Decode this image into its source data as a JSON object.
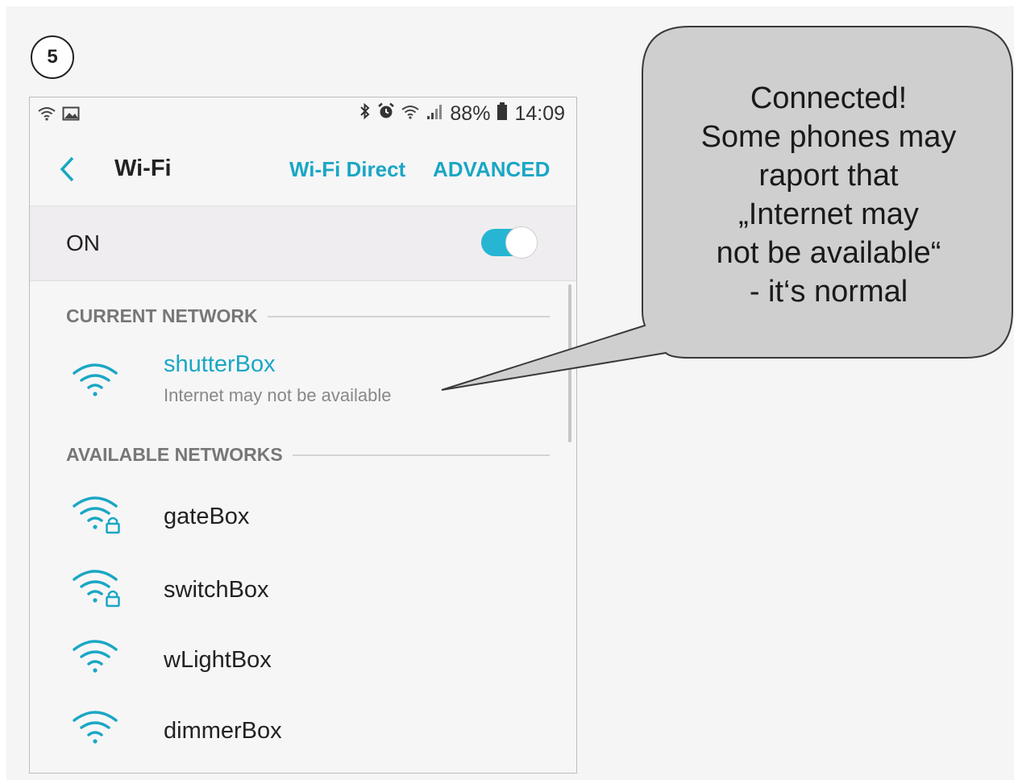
{
  "step": {
    "number": "5"
  },
  "statusbar": {
    "left_icons": [
      "wifi-icon",
      "image-icon"
    ],
    "right_icons": [
      "bluetooth-icon",
      "alarm-icon",
      "wifi-icon",
      "signal-icon",
      "battery-icon"
    ],
    "battery": "88%",
    "time": "14:09"
  },
  "appbar": {
    "title": "Wi-Fi",
    "wifi_direct": "Wi-Fi Direct",
    "advanced": "ADVANCED"
  },
  "toggle": {
    "label": "ON",
    "state": "on"
  },
  "current_network": {
    "header": "CURRENT NETWORK",
    "name": "shutterBox",
    "status": "Internet may not be available"
  },
  "available_networks": {
    "header": "AVAILABLE NETWORKS",
    "items": [
      {
        "name": "gateBox",
        "secured": true
      },
      {
        "name": "switchBox",
        "secured": true
      },
      {
        "name": "wLightBox",
        "secured": false
      },
      {
        "name": "dimmerBox",
        "secured": false
      }
    ]
  },
  "callout": {
    "lines": [
      "Connected!",
      "Some phones may",
      "raport that",
      "„Internet may",
      "not be available“",
      "- it‘s normal"
    ]
  },
  "colors": {
    "accent": "#1aa7c4",
    "toggle_track": "#27b5d4",
    "callout_fill": "#cfcfcf"
  }
}
